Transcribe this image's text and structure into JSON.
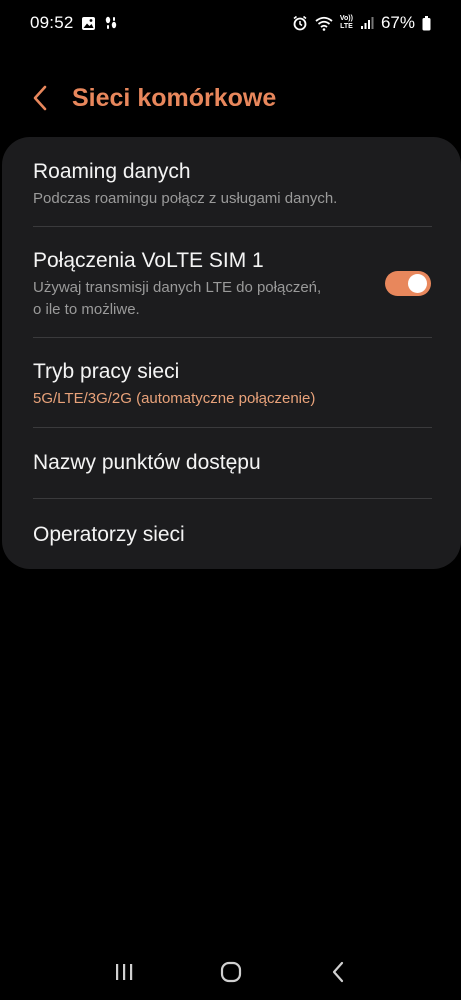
{
  "colors": {
    "accent": "#e8875c",
    "accent_sub": "#e8a27a",
    "card_bg": "#1c1c1e",
    "background": "#000000"
  },
  "status_bar": {
    "time": "09:52",
    "battery": "67%",
    "left_icons": [
      "image-icon",
      "activity-icon"
    ],
    "right_icons": [
      "alarm-icon",
      "wifi-icon",
      "volte-lte-icon",
      "signal-icon",
      "battery-icon"
    ],
    "volte_top": "Vo))",
    "volte_bottom": "LTE"
  },
  "header": {
    "title": "Sieci komórkowe",
    "back_icon": "chevron-left-icon"
  },
  "settings": {
    "roaming": {
      "title": "Roaming danych",
      "subtitle": "Podczas roamingu połącz z usługami danych."
    },
    "volte": {
      "title": "Połączenia VoLTE SIM 1",
      "subtitle_line1": "Używaj transmisji danych LTE do połączeń,",
      "subtitle_line2": "o ile to możliwe.",
      "enabled": true
    },
    "network_mode": {
      "title": "Tryb pracy sieci",
      "value": "5G/LTE/3G/2G (automatyczne połączenie)"
    },
    "apn": {
      "title": "Nazwy punktów dostępu"
    },
    "operators": {
      "title": "Operatorzy sieci"
    }
  },
  "nav_bar": {
    "items": [
      "recents-icon",
      "home-icon",
      "back-icon"
    ]
  }
}
